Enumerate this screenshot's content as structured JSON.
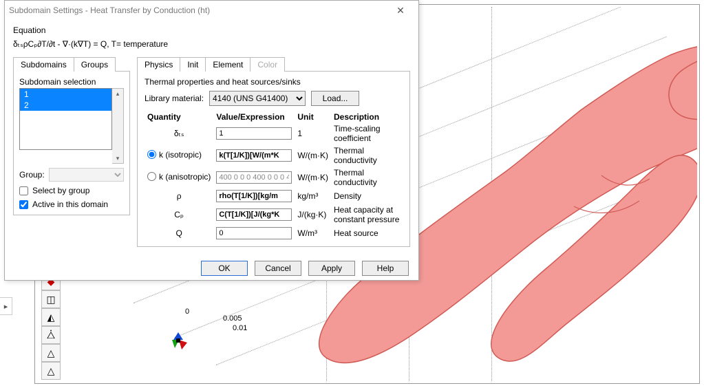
{
  "dialog": {
    "title": "Subdomain Settings - Heat Transfer by Conduction (ht)",
    "equation_label": "Equation",
    "equation_html": "δₜₛρCₚ∂T/∂t - ∇·(k∇T) = Q, T= temperature"
  },
  "left": {
    "tabs": {
      "subdomains": "Subdomains",
      "groups": "Groups"
    },
    "selection_label": "Subdomain selection",
    "items": [
      "1",
      "2"
    ],
    "group_label": "Group:",
    "select_by_group": "Select by group",
    "active_in_domain": "Active in this domain",
    "select_by_group_checked": false,
    "active_checked": true
  },
  "right": {
    "tabs": {
      "physics": "Physics",
      "init": "Init",
      "element": "Element",
      "color": "Color"
    },
    "desc": "Thermal properties and heat sources/sinks",
    "library_label": "Library material:",
    "library_value": "4140 (UNS G41400)",
    "load_label": "Load...",
    "headers": {
      "quantity": "Quantity",
      "value": "Value/Expression",
      "unit": "Unit",
      "description": "Description"
    },
    "rows": {
      "dts": {
        "q": "δₜₛ",
        "val": "1",
        "unit": "1",
        "desc": "Time-scaling coefficient"
      },
      "kiso": {
        "q": "k (isotropic)",
        "val": "k(T[1/K])[W/(m*K",
        "unit": "W/(m·K)",
        "desc": "Thermal conductivity"
      },
      "kaniso": {
        "q": "k (anisotropic)",
        "val": "400 0 0 0 400 0 0 0 4",
        "unit": "W/(m·K)",
        "desc": "Thermal conductivity"
      },
      "rho": {
        "q": "ρ",
        "val": "rho(T[1/K])[kg/m",
        "unit": "kg/m³",
        "desc": "Density"
      },
      "cp": {
        "q": "Cₚ",
        "val": "C(T[1/K])[J/(kg*K",
        "unit": "J/(kg·K)",
        "desc": "Heat capacity at constant pressure"
      },
      "q": {
        "q": "Q",
        "val": "0",
        "unit": "W/m³",
        "desc": "Heat source"
      }
    }
  },
  "footer": {
    "ok": "OK",
    "cancel": "Cancel",
    "apply": "Apply",
    "help": "Help"
  },
  "canvas": {
    "ticks": [
      "0",
      "0.005",
      "0.01"
    ]
  }
}
